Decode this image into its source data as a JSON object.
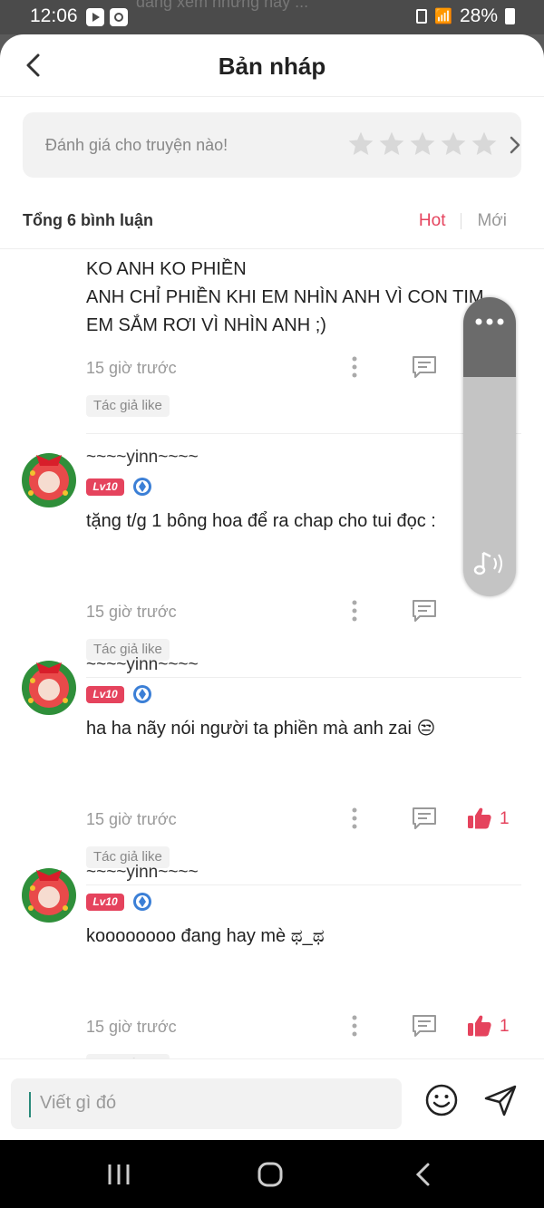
{
  "status_bar": {
    "time": "12:06",
    "battery": "28%",
    "ghost_text": "đang xem nhưng hãy ..."
  },
  "header": {
    "title": "Bản nháp"
  },
  "rating": {
    "prompt": "Đánh giá cho truyện nào!",
    "stars": 5
  },
  "summary": {
    "total": "Tổng 6 bình luận"
  },
  "sort": {
    "hot": "Hot",
    "new": "Mới"
  },
  "comments": [
    {
      "text_lines": [
        "KO ANH KO PHIỀN",
        "ANH CHỈ PHIỀN KHI EM NHÌN ANH VÌ CON TIM",
        "EM SẮM RƠI VÌ NHÌN ANH ;)"
      ],
      "time": "15 giờ trước",
      "author_like": "Tác giả like"
    },
    {
      "username": "~~~~yinn~~~~",
      "level": "Lv10",
      "text": "tặng t/g 1 bông hoa để ra chap cho tui đọc :",
      "time": "15 giờ trước",
      "author_like": "Tác giả like"
    },
    {
      "username": "~~~~yinn~~~~",
      "level": "Lv10",
      "text": "ha ha nãy nói người ta phiền mà anh zai 😒",
      "time": "15 giờ trước",
      "likes": "1",
      "author_like": "Tác giả like"
    },
    {
      "username": "~~~~yinn~~~~",
      "level": "Lv10",
      "text": "koooooooo đang hay mè ಥ_ಥ",
      "time": "15 giờ trước",
      "likes": "1",
      "author_like": "Tác giả like"
    }
  ],
  "input": {
    "placeholder": "Viết gì đó"
  },
  "colors": {
    "accent": "#e5435d",
    "star": "#d8d8d8"
  }
}
